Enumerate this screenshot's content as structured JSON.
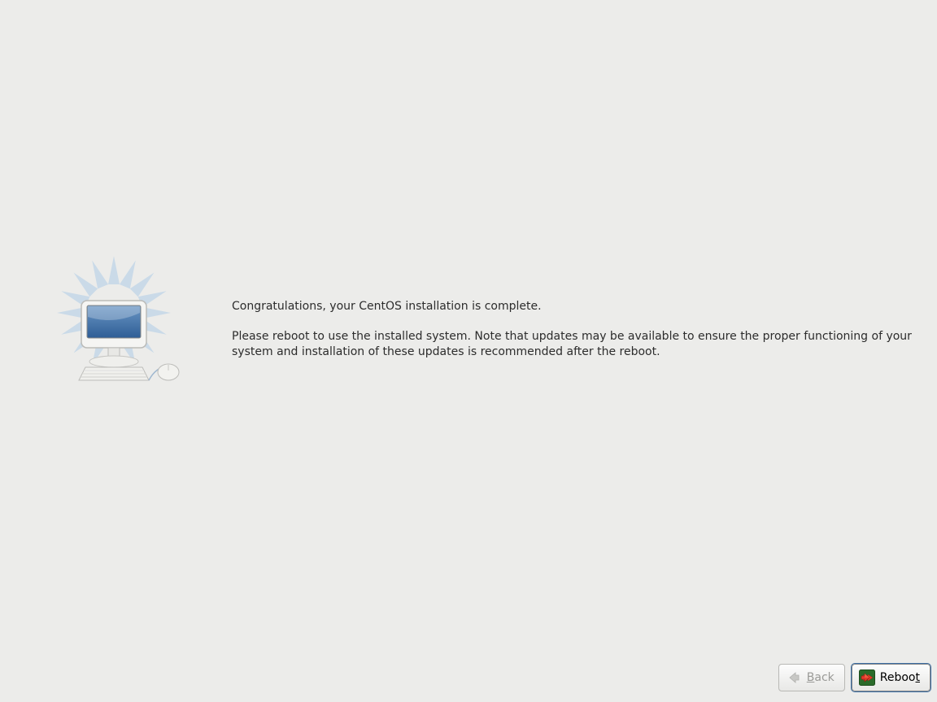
{
  "main": {
    "congrats_line": "Congratulations, your CentOS installation is complete.",
    "instructions_line": "Please reboot to use the installed system.  Note that updates may be available to ensure the proper functioning of your system and installation of these updates is recommended after the reboot."
  },
  "buttons": {
    "back": {
      "label_prefix": "",
      "label_underlined": "B",
      "label_suffix": "ack",
      "enabled": false
    },
    "reboot": {
      "label_prefix": "Reboo",
      "label_underlined": "t",
      "label_suffix": "",
      "enabled": true,
      "default": true
    }
  },
  "icons": {
    "computer": "computer-icon",
    "back_arrow": "arrow-left-icon",
    "reboot_arrow": "arrow-right-icon"
  }
}
